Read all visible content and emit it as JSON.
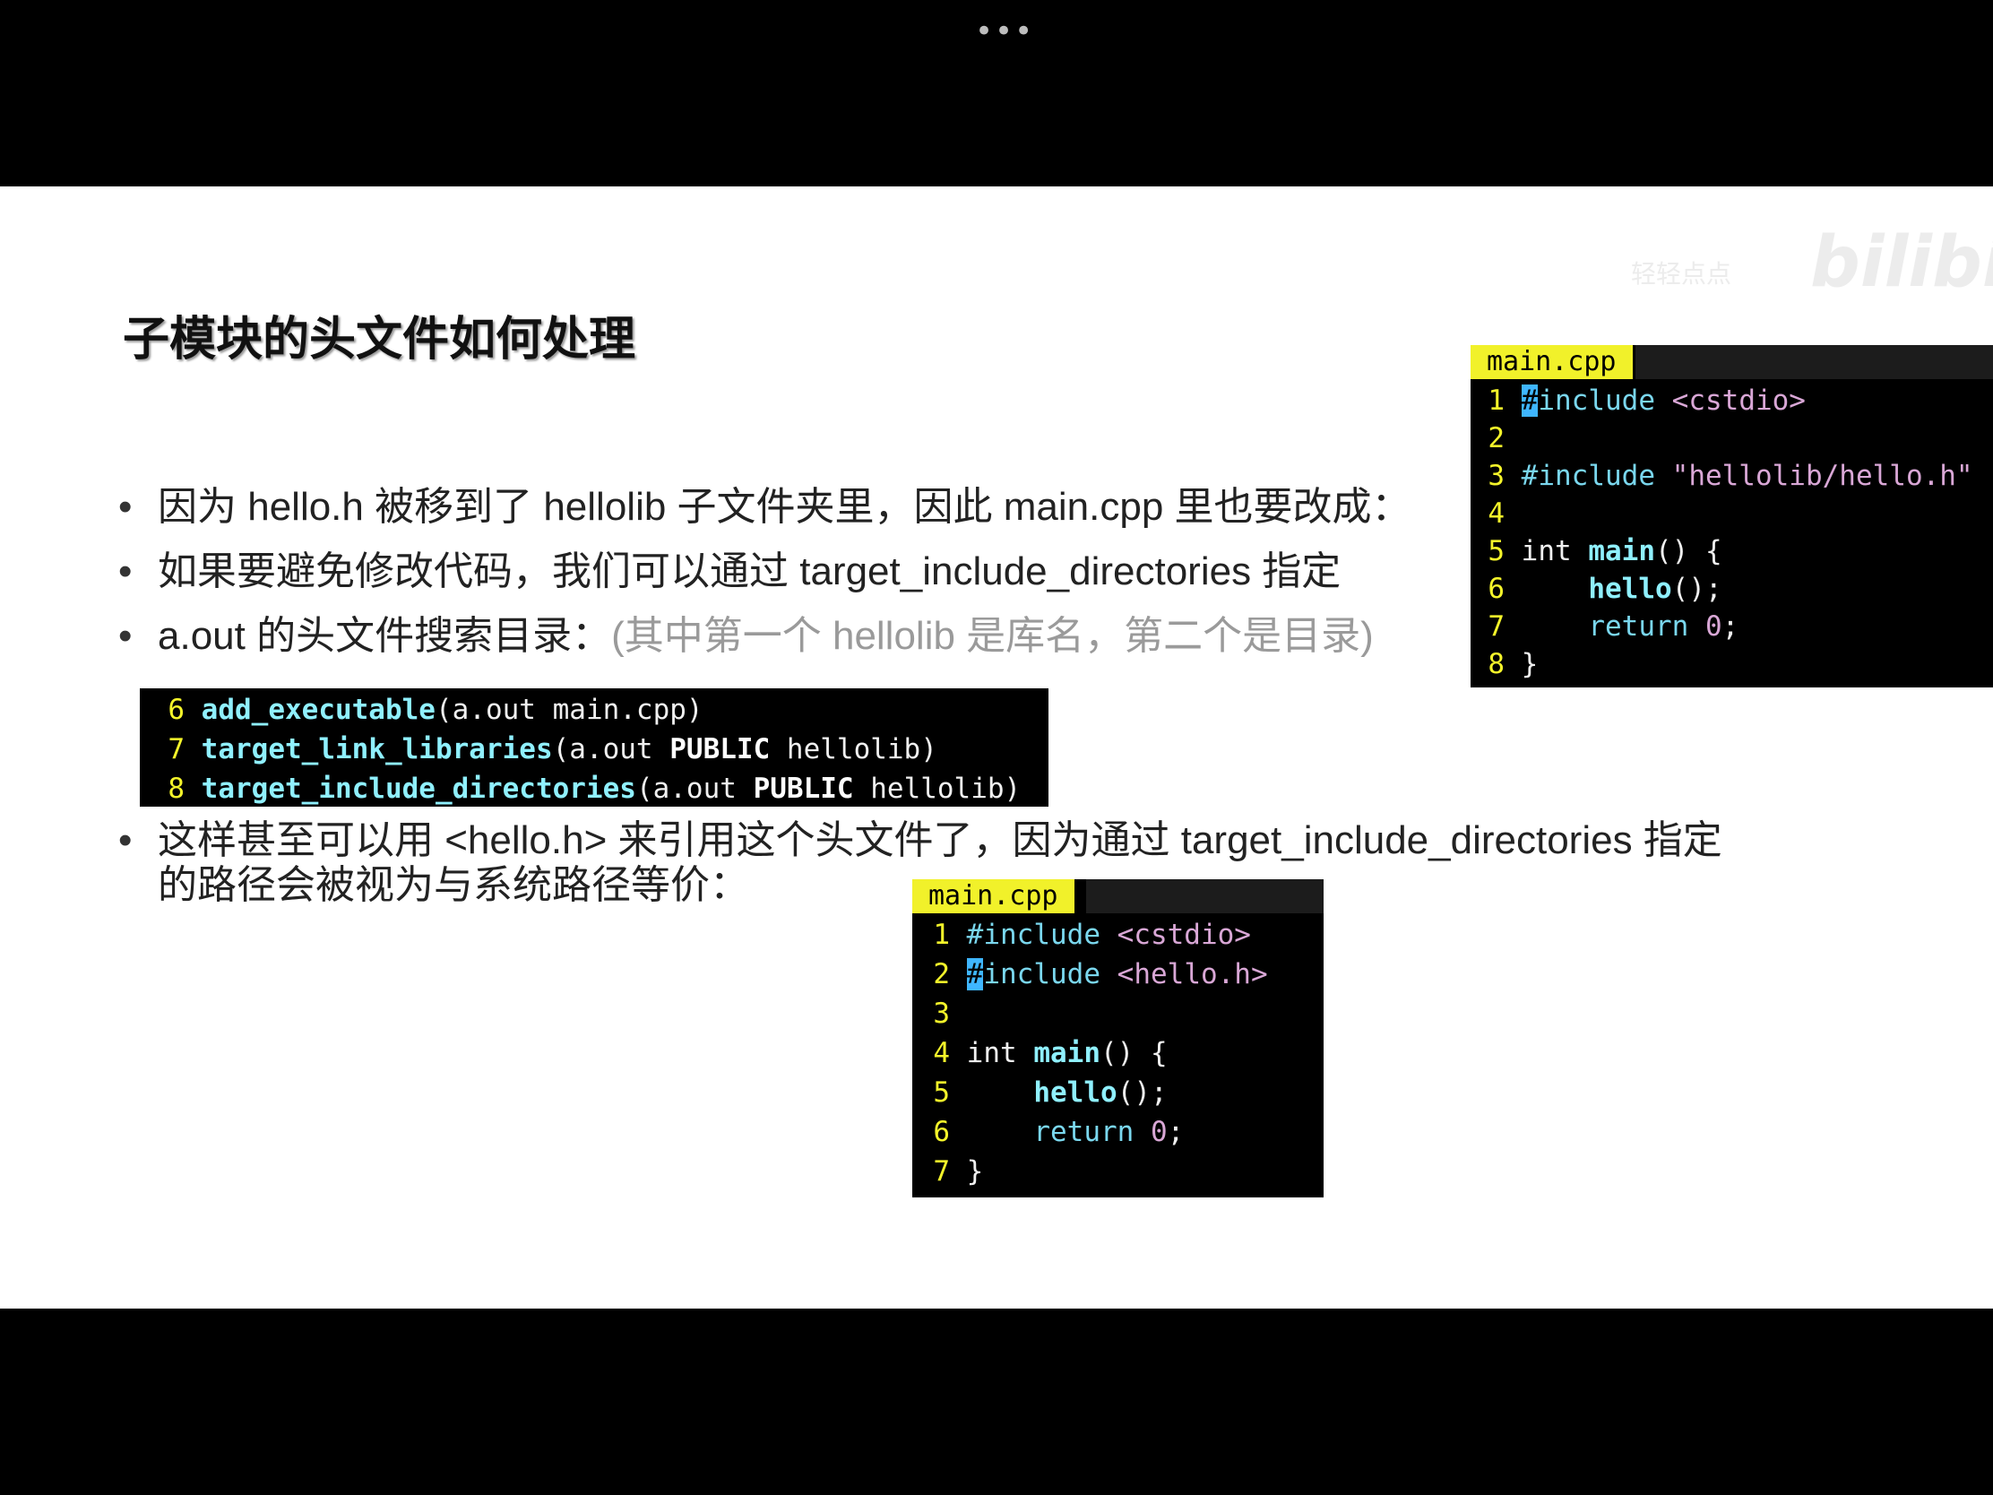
{
  "window": {
    "more_menu": "•••"
  },
  "watermark": {
    "text": "轻轻点点",
    "logo": "bilibili"
  },
  "slide": {
    "title": "子模块的头文件如何处理",
    "bullets": [
      {
        "text": "因为 hello.h 被移到了 hellolib 子文件夹里，因此 main.cpp 里也要改成："
      },
      {
        "text": "如果要避免修改代码，我们可以通过 target_include_directories 指定"
      },
      {
        "text": "a.out 的头文件搜索目录：",
        "note": "(其中第一个 hellolib 是库名，第二个是目录)"
      },
      {
        "text_line1": "这样甚至可以用 <hello.h> 来引用这个头文件了，因为通过 target_include_directories 指定",
        "text_line2": "的路径会被视为与系统路径等价："
      }
    ]
  },
  "code_top": {
    "tab": "main.cpp",
    "lines": [
      {
        "n": "1",
        "a": "#",
        "b": "include",
        "c": " <cstdio>"
      },
      {
        "n": "2"
      },
      {
        "n": "3",
        "a": "#include ",
        "b": "\"hellolib/hello.h\""
      },
      {
        "n": "4"
      },
      {
        "n": "5",
        "a": "int ",
        "b": "main",
        "c": "() {"
      },
      {
        "n": "6",
        "a": "    ",
        "b": "hello",
        "c": "();"
      },
      {
        "n": "7",
        "a": "    return ",
        "b": "0",
        "c": ";"
      },
      {
        "n": "8",
        "a": "}"
      }
    ]
  },
  "code_cmake": {
    "lines": [
      {
        "n": "6",
        "fn": "add_executable",
        "rest": "(a.out main.cpp)"
      },
      {
        "n": "7",
        "fn": "target_link_libraries",
        "p1": "(a.out ",
        "kw": "PUBLIC",
        "p2": " hellolib)"
      },
      {
        "n": "8",
        "fn": "target_include_directories",
        "p1": "(a.out ",
        "kw": "PUBLIC",
        "p2": " hellolib)"
      }
    ]
  },
  "code_bottom": {
    "tab": "main.cpp",
    "lines": [
      {
        "n": "1",
        "a": "#include",
        "b": " <cstdio>"
      },
      {
        "n": "2",
        "cur": "#",
        "a": "include",
        "b": " <hello.h>"
      },
      {
        "n": "3"
      },
      {
        "n": "4",
        "a": "int ",
        "b": "main",
        "c": "() {"
      },
      {
        "n": "5",
        "a": "    ",
        "b": "hello",
        "c": "();"
      },
      {
        "n": "6",
        "a": "    return ",
        "b": "0",
        "c": ";"
      },
      {
        "n": "7",
        "a": "}"
      }
    ]
  },
  "toolbar": {
    "pen": "✎",
    "curve": "∿",
    "highlighter": "✐",
    "eraser": "⌫",
    "pointer": "➚",
    "camera": "■"
  }
}
